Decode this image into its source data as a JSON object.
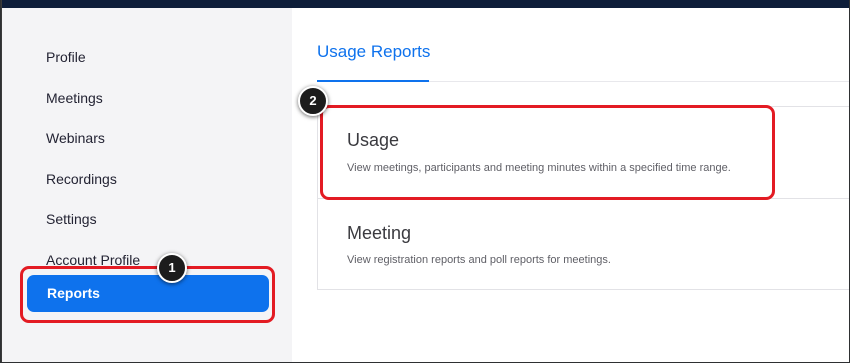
{
  "sidebar": {
    "items": [
      {
        "label": "Profile"
      },
      {
        "label": "Meetings"
      },
      {
        "label": "Webinars"
      },
      {
        "label": "Recordings"
      },
      {
        "label": "Settings"
      },
      {
        "label": "Account Profile"
      },
      {
        "label": "Reports",
        "active": true
      }
    ]
  },
  "tabs": [
    {
      "label": "Usage Reports",
      "active": true
    }
  ],
  "cards": [
    {
      "title": "Usage",
      "description": "View meetings, participants and meeting minutes within a specified time range."
    },
    {
      "title": "Meeting",
      "description": "View registration reports and poll reports for meetings."
    }
  ],
  "callouts": [
    {
      "number": "1"
    },
    {
      "number": "2"
    }
  ],
  "colors": {
    "accent": "#0e72ed",
    "highlight": "#e31b23",
    "topbar": "#0e1e3a"
  }
}
